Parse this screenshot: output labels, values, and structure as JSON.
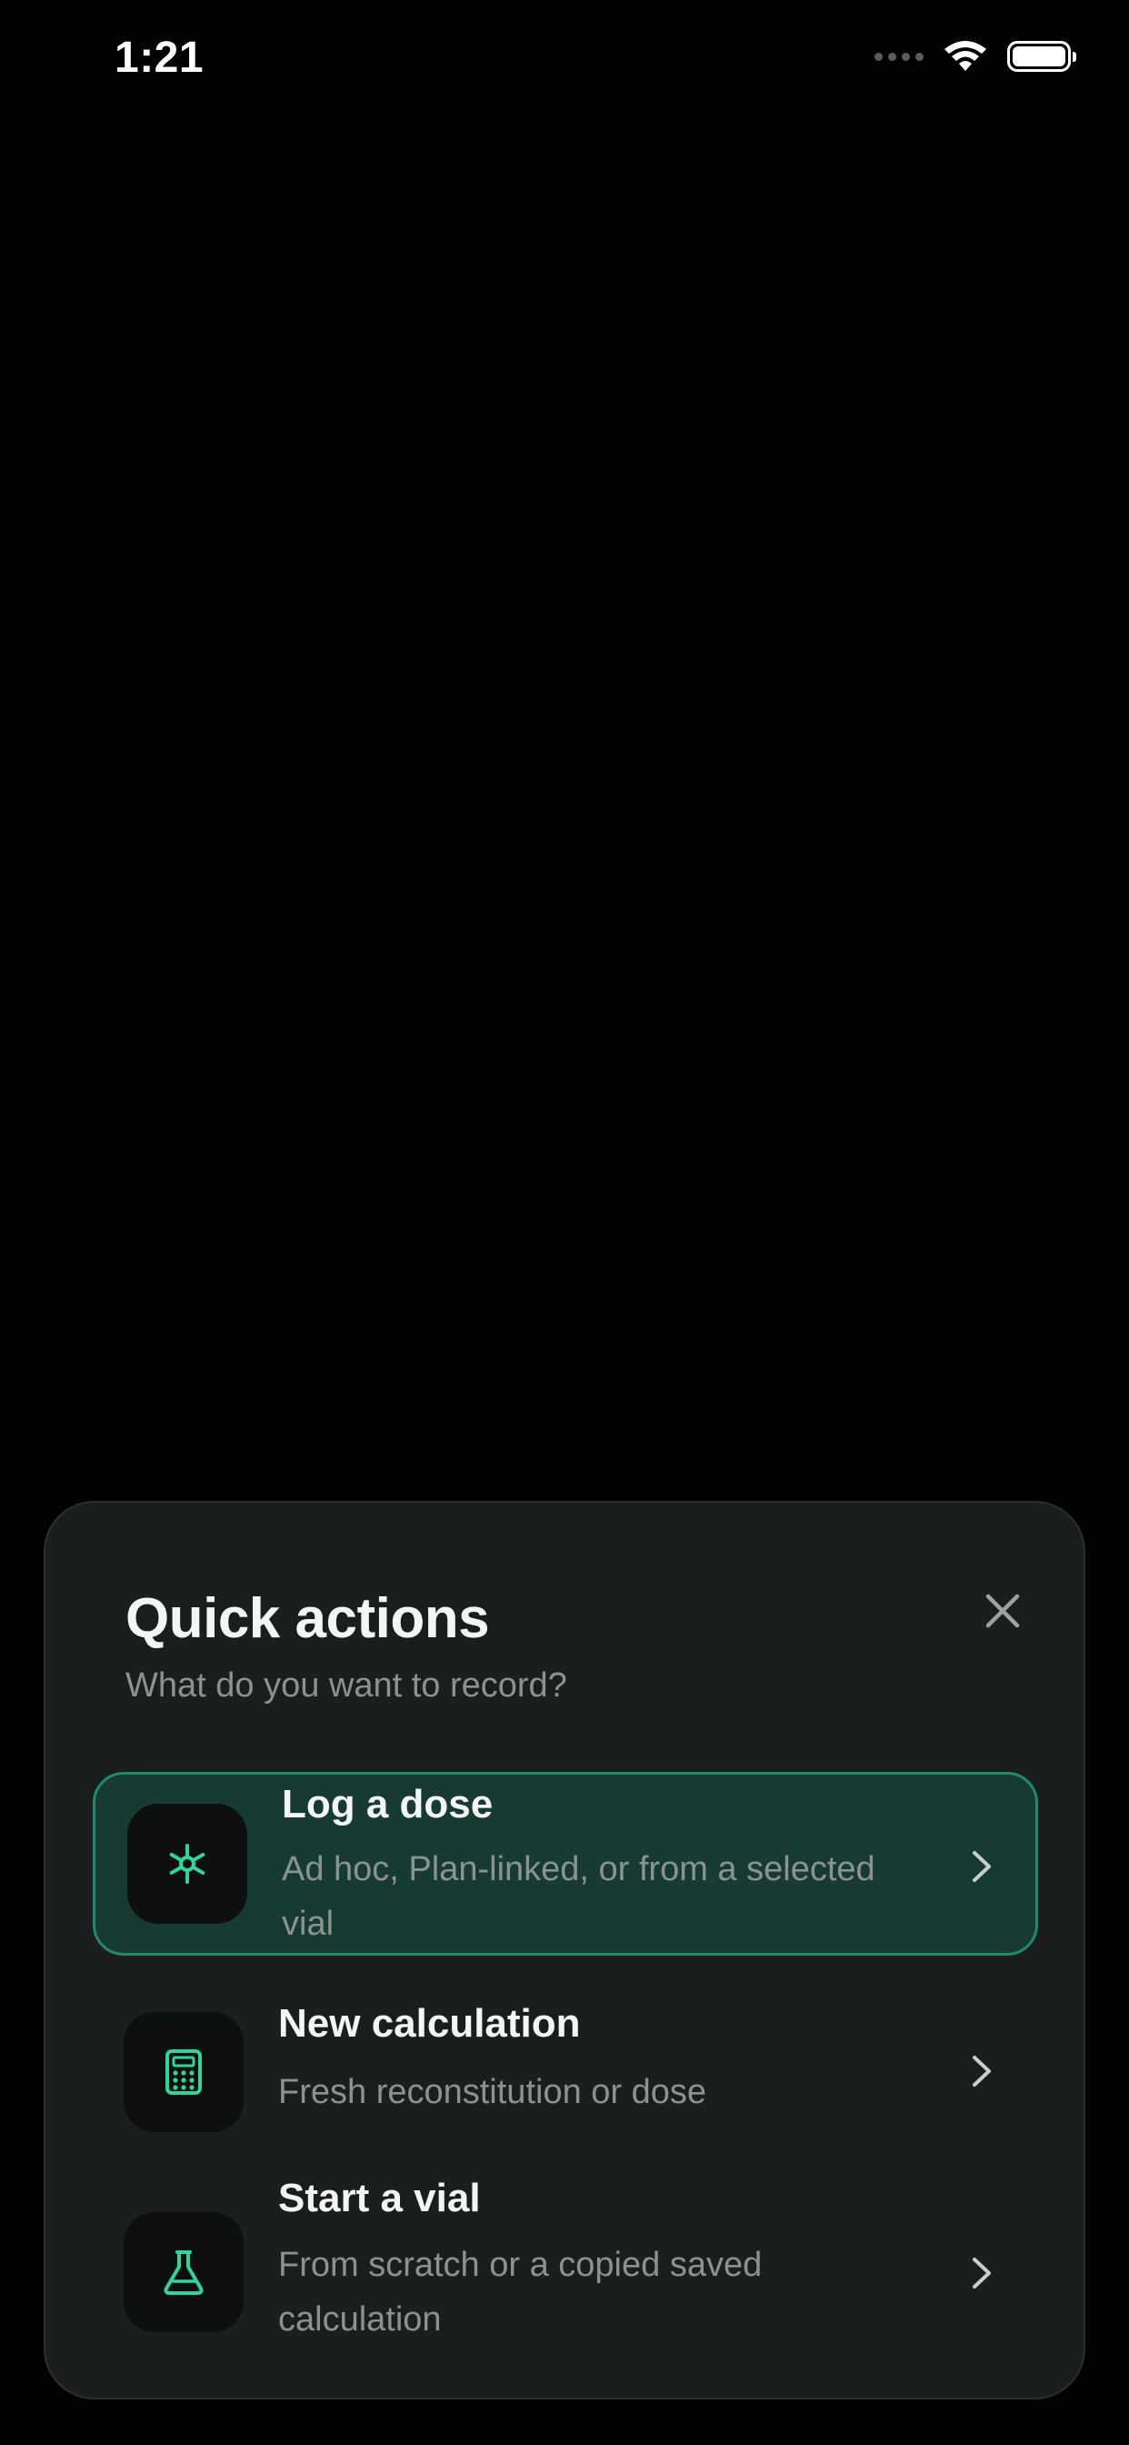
{
  "status_bar": {
    "time": "1:21",
    "icons": [
      "signal-dots-icon",
      "wifi-icon",
      "battery-icon"
    ]
  },
  "sheet": {
    "title": "Quick actions",
    "subtitle": "What do you want to record?",
    "close_icon": "close-icon",
    "actions": [
      {
        "title": "Log a dose",
        "description": "Ad hoc, Plan-linked, or from a selected vial",
        "icon": "asterisk-icon",
        "selected": true
      },
      {
        "title": "New calculation",
        "description": "Fresh reconstitution or dose",
        "icon": "calculator-icon",
        "selected": false
      },
      {
        "title": "Start a vial",
        "description": "From scratch or a copied saved calculation",
        "icon": "flask-icon",
        "selected": false
      }
    ]
  },
  "colors": {
    "background": "#020202",
    "sheet": "#1a1e1d",
    "accent": "#34d399",
    "selected_bg": "#173b33",
    "selected_border": "#23896b",
    "text_secondary": "#8b9391"
  }
}
